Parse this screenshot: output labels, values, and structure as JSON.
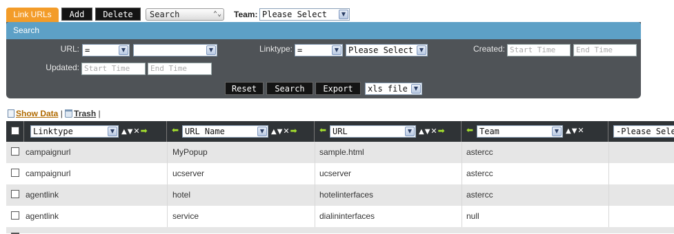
{
  "toolbar": {
    "tab_label": "Link URLs",
    "add_label": "Add",
    "delete_label": "Delete",
    "search_dropdown": "Search",
    "team_label": "Team:",
    "team_value": "Please Select"
  },
  "search_panel": {
    "title": "Search",
    "url_label": "URL:",
    "url_operator": "=",
    "url_value": "",
    "linktype_label": "Linktype:",
    "linktype_operator": "=",
    "linktype_value": "Please Select",
    "created_label": "Created:",
    "created_start_placeholder": "Start Time",
    "created_end_placeholder": "End Time",
    "updated_label": "Updated:",
    "updated_start_placeholder": "Start Time",
    "updated_end_placeholder": "End Time",
    "reset_label": "Reset",
    "search_label": "Search",
    "export_label": "Export",
    "export_format": "xls file"
  },
  "links": {
    "show_data": "Show Data",
    "trash": "Trash",
    "sep1": "|",
    "sep2": "|"
  },
  "grid": {
    "columns": [
      {
        "label": "Linktype"
      },
      {
        "label": "URL Name"
      },
      {
        "label": "URL"
      },
      {
        "label": "Team"
      },
      {
        "label": "-Please Select-"
      }
    ],
    "rows": [
      {
        "linktype": "campaignurl",
        "url_name": "MyPopup",
        "url": "sample.html",
        "team": "astercc"
      },
      {
        "linktype": "campaignurl",
        "url_name": "ucserver",
        "url": "ucserver",
        "team": "astercc"
      },
      {
        "linktype": "agentlink",
        "url_name": "hotel",
        "url": "hotelinterfaces",
        "team": "astercc"
      },
      {
        "linktype": "agentlink",
        "url_name": "service",
        "url": "dialininterfaces",
        "team": "null"
      }
    ]
  },
  "colors": {
    "tab_orange": "#f39c29",
    "panel_header_blue": "#5da0c6",
    "panel_bg": "#4f5357",
    "grid_header": "#2f3336",
    "alt_row": "#e6e6e6"
  }
}
